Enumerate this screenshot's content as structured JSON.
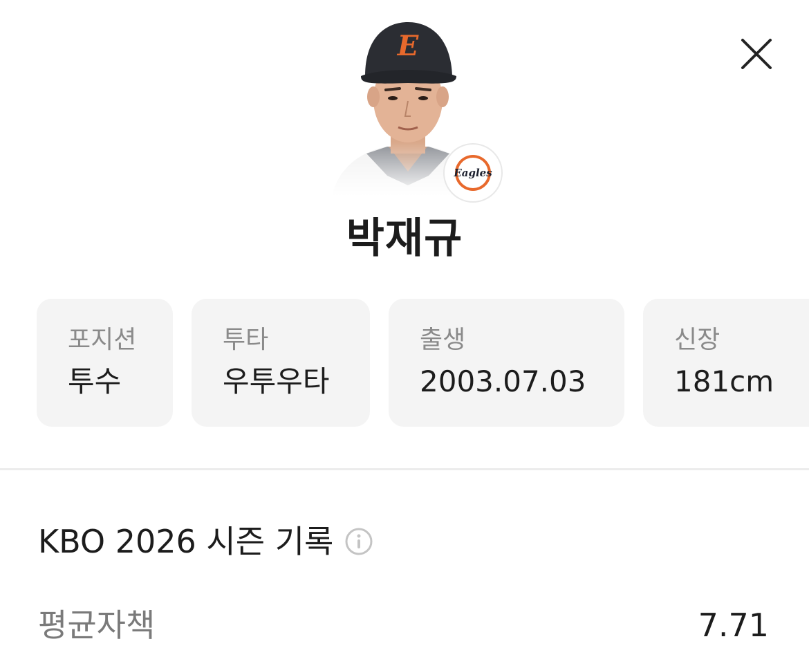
{
  "player": {
    "name": "박재규",
    "team_logo_text": "Eagles",
    "cap_letter": "E"
  },
  "profile_cards": [
    {
      "label": "포지션",
      "value": "투수"
    },
    {
      "label": "투타",
      "value": "우투우타"
    },
    {
      "label": "출생",
      "value": "2003.07.03"
    },
    {
      "label": "신장",
      "value": "181cm"
    }
  ],
  "season": {
    "title": "KBO 2026 시즌 기록",
    "stats": [
      {
        "label": "평균자책",
        "value": "7.71"
      }
    ]
  },
  "icons": {
    "close": "close-icon",
    "info": "info-icon"
  },
  "colors": {
    "team_orange": "#e8692c",
    "card_bg": "#f4f4f4",
    "label_gray": "#8a8a8a"
  }
}
